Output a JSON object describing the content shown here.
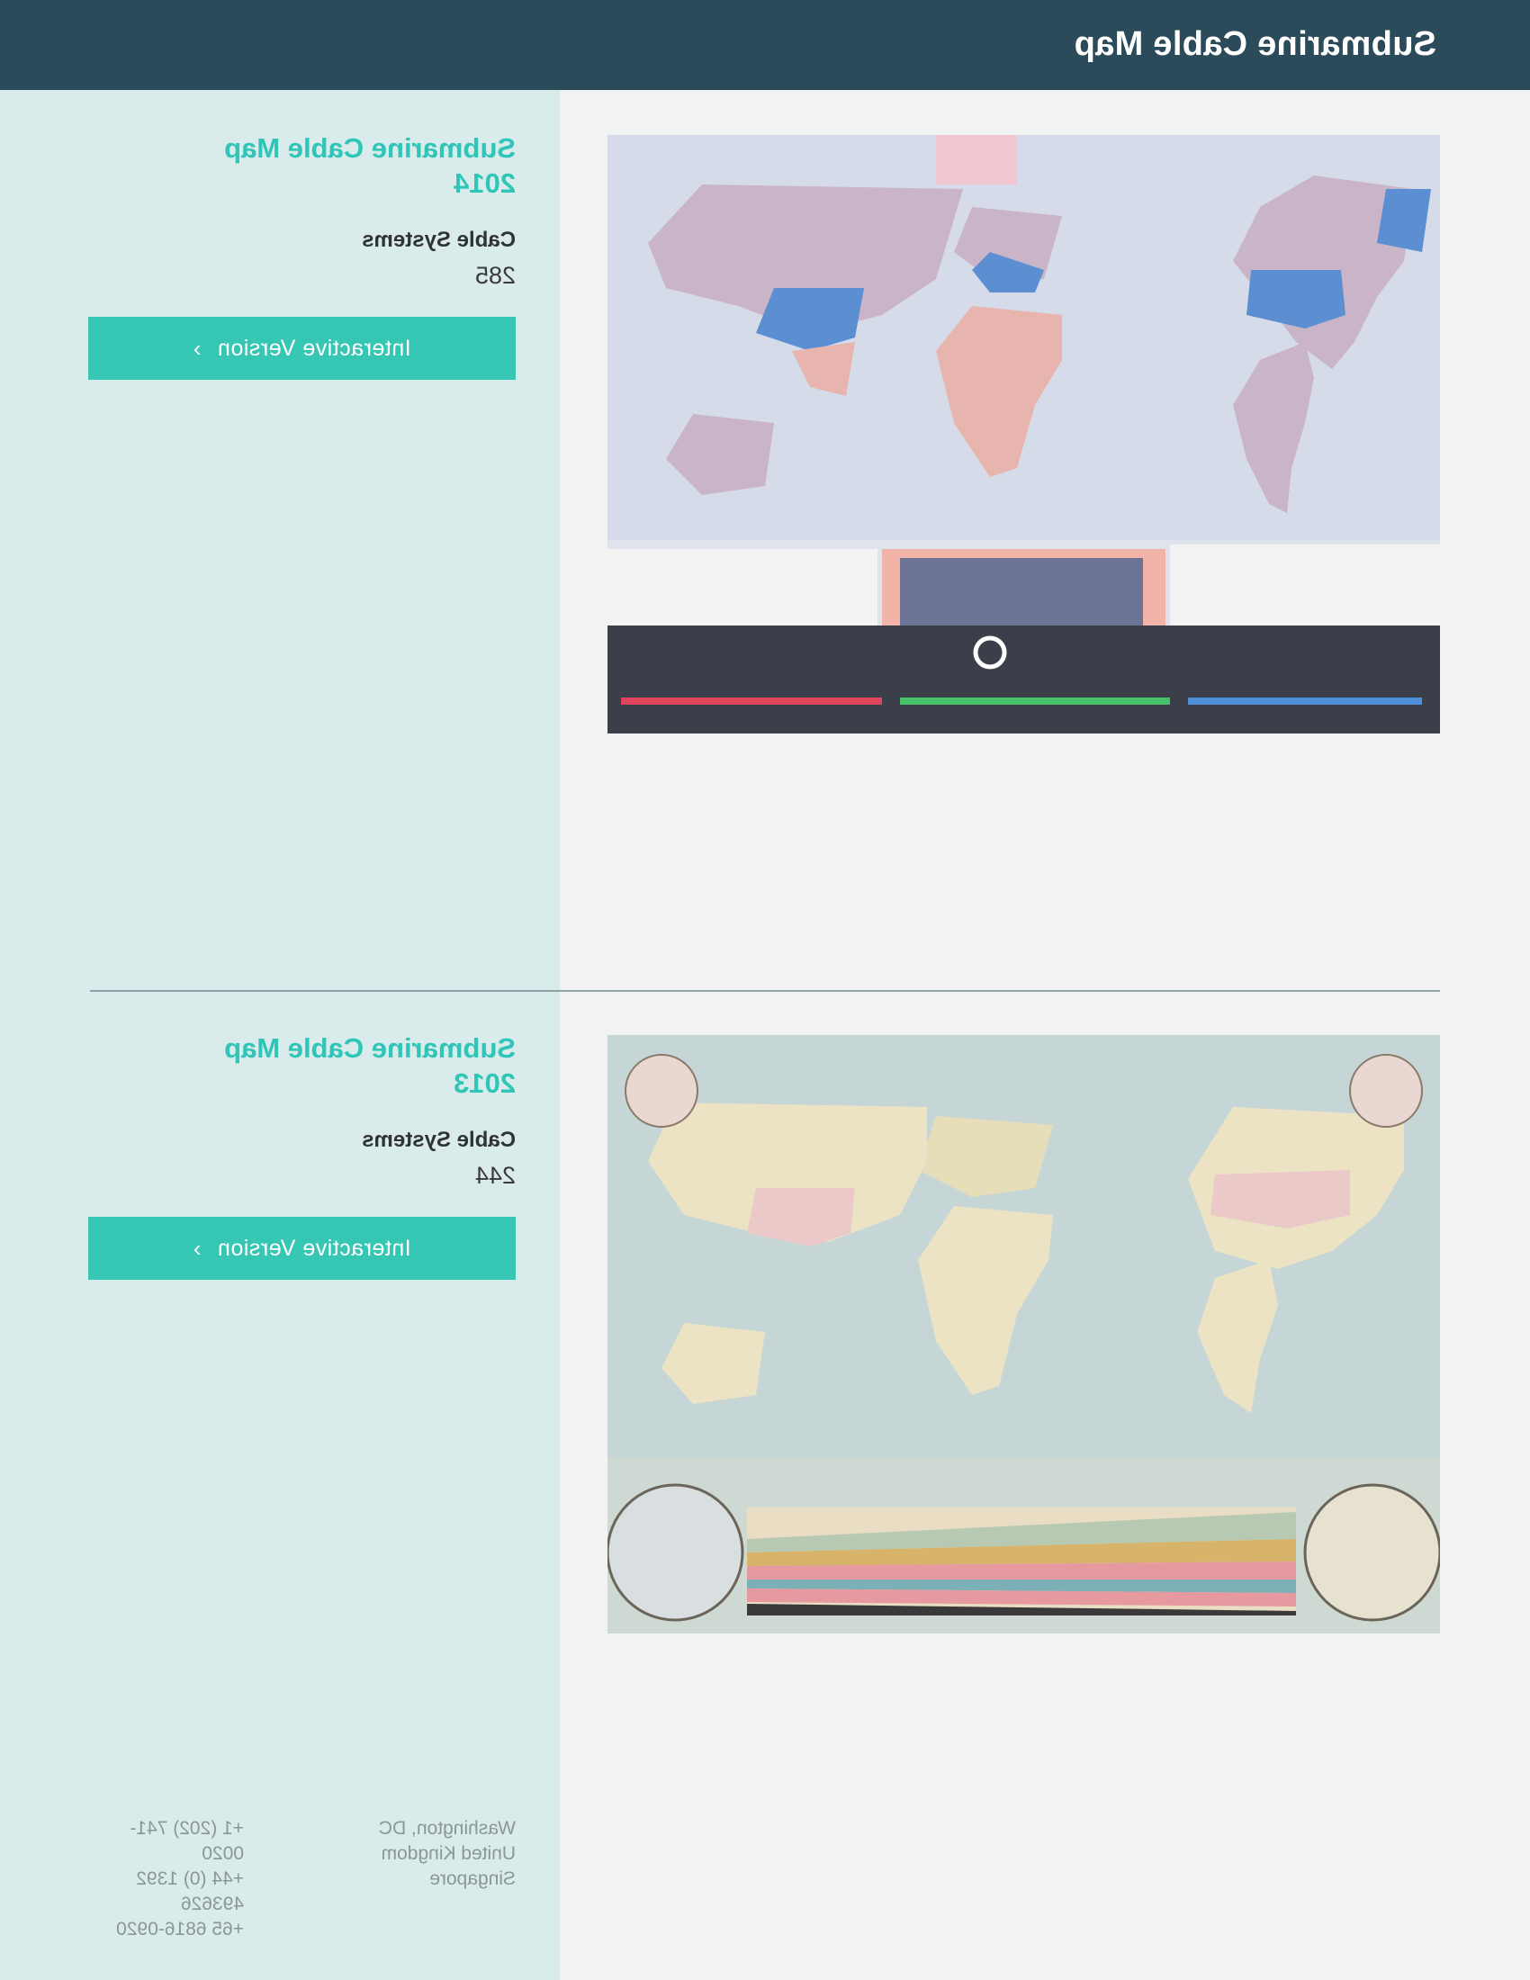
{
  "header": {
    "title": "Submarine Cable Map"
  },
  "maps": [
    {
      "title_line1": "Submarine Cable Map",
      "title_line2": "2014",
      "stat_label": "Cable Systems",
      "stat_value": "285",
      "button_label": "Interactive Version",
      "image_icon": "world-map-2014"
    },
    {
      "title_line1": "Submarine Cable Map",
      "title_line2": "2013",
      "stat_label": "Cable Systems",
      "stat_value": "244",
      "button_label": "Interactive Version",
      "image_icon": "world-map-2013"
    }
  ],
  "footer": {
    "cities": [
      "Washington, DC",
      "United Kingdom",
      "Singapore"
    ],
    "phones": [
      "+1 (202) 741-0020",
      "+44 (0) 1392 493626",
      "+65 6816-0920"
    ]
  },
  "colors": {
    "header_bg": "#2b4b5a",
    "sidebar_bg": "#d9ebea",
    "accent": "#35c7b4",
    "title_accent": "#2fc6b8"
  }
}
